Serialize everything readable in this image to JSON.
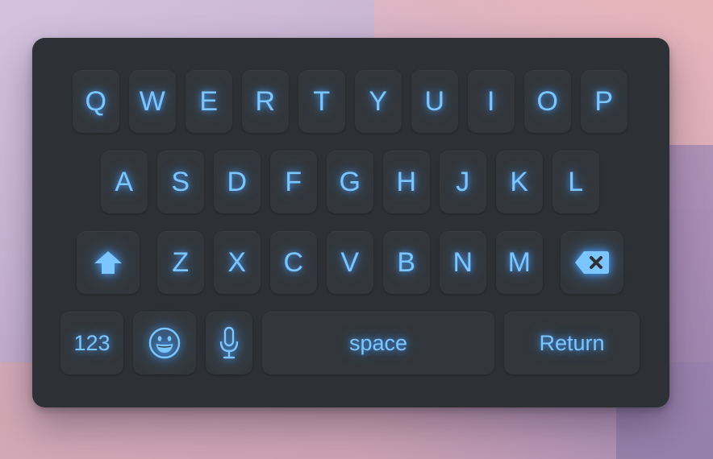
{
  "colors": {
    "keyboard_background": "#2d3034",
    "key_background": "#33373c",
    "key_glow": "#7cc6ff"
  },
  "rows": [
    {
      "keys": [
        "Q",
        "W",
        "E",
        "R",
        "T",
        "Y",
        "U",
        "I",
        "O",
        "P"
      ]
    },
    {
      "keys": [
        "A",
        "S",
        "D",
        "F",
        "G",
        "H",
        "J",
        "K",
        "L"
      ]
    },
    {
      "keys": [
        "Z",
        "X",
        "C",
        "V",
        "B",
        "N",
        "M"
      ]
    }
  ],
  "special_keys": {
    "shift": {
      "icon": "shift-arrow-icon"
    },
    "backspace": {
      "icon": "backspace-icon"
    },
    "numbers": {
      "label": "123"
    },
    "emoji": {
      "icon": "smiley-face-icon"
    },
    "microphone": {
      "icon": "microphone-icon"
    },
    "space": {
      "label": "space"
    },
    "return": {
      "label": "Return"
    }
  }
}
